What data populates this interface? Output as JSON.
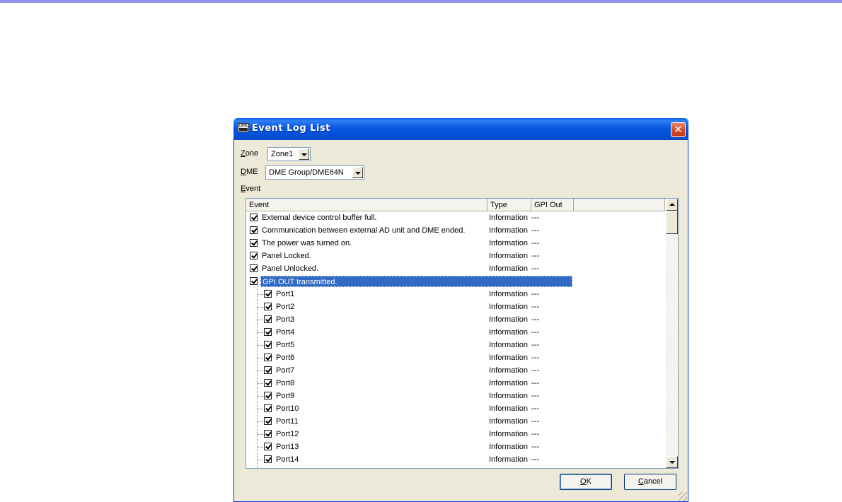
{
  "window": {
    "title": "Event Log List",
    "icon": "dme-app-icon",
    "icon_text": "DME"
  },
  "zone": {
    "label": "Zone",
    "mnemonic": "Z",
    "label_rest": "one",
    "value": "Zone1"
  },
  "dme": {
    "label": "DME",
    "mnemonic": "D",
    "label_rest": "ME",
    "value": "DME Group/DME64N"
  },
  "event_label": {
    "mnemonic": "E",
    "label_rest": "vent"
  },
  "columns": {
    "event": "Event",
    "type": "Type",
    "gpi_out": "GPI Out"
  },
  "rows": [
    {
      "event": "External device control buffer full.",
      "type": "Information",
      "gpi": "---",
      "checked": true
    },
    {
      "event": "Communication between external AD unit and DME ended.",
      "type": "Information",
      "gpi": "---",
      "checked": true
    },
    {
      "event": "The power was turned on.",
      "type": "Information",
      "gpi": "---",
      "checked": true
    },
    {
      "event": "Panel Locked.",
      "type": "Information",
      "gpi": "---",
      "checked": true
    },
    {
      "event": "Panel Unlocked.",
      "type": "Information",
      "gpi": "---",
      "checked": true
    },
    {
      "event": "GPI OUT transmitted.",
      "type": "",
      "gpi": "",
      "checked": true,
      "selected": true
    },
    {
      "event": "Port1",
      "type": "Information",
      "gpi": "---",
      "checked": true,
      "child": true
    },
    {
      "event": "Port2",
      "type": "Information",
      "gpi": "---",
      "checked": true,
      "child": true
    },
    {
      "event": "Port3",
      "type": "Information",
      "gpi": "---",
      "checked": true,
      "child": true
    },
    {
      "event": "Port4",
      "type": "Information",
      "gpi": "---",
      "checked": true,
      "child": true
    },
    {
      "event": "Port5",
      "type": "Information",
      "gpi": "---",
      "checked": true,
      "child": true
    },
    {
      "event": "Port6",
      "type": "Information",
      "gpi": "---",
      "checked": true,
      "child": true
    },
    {
      "event": "Port7",
      "type": "Information",
      "gpi": "---",
      "checked": true,
      "child": true
    },
    {
      "event": "Port8",
      "type": "Information",
      "gpi": "---",
      "checked": true,
      "child": true
    },
    {
      "event": "Port9",
      "type": "Information",
      "gpi": "---",
      "checked": true,
      "child": true
    },
    {
      "event": "Port10",
      "type": "Information",
      "gpi": "---",
      "checked": true,
      "child": true
    },
    {
      "event": "Port11",
      "type": "Information",
      "gpi": "---",
      "checked": true,
      "child": true
    },
    {
      "event": "Port12",
      "type": "Information",
      "gpi": "---",
      "checked": true,
      "child": true
    },
    {
      "event": "Port13",
      "type": "Information",
      "gpi": "---",
      "checked": true,
      "child": true
    },
    {
      "event": "Port14",
      "type": "Information",
      "gpi": "---",
      "checked": true,
      "child": true
    }
  ],
  "buttons": {
    "ok": {
      "mnemonic": "O",
      "label_rest": "K"
    },
    "cancel": {
      "mnemonic": "C",
      "label_rest": "ancel"
    }
  },
  "colors": {
    "title_bar": "#0a5fe8",
    "selection": "#316ac5",
    "close_button": "#d04a24",
    "top_accent": "#8f90e6"
  }
}
